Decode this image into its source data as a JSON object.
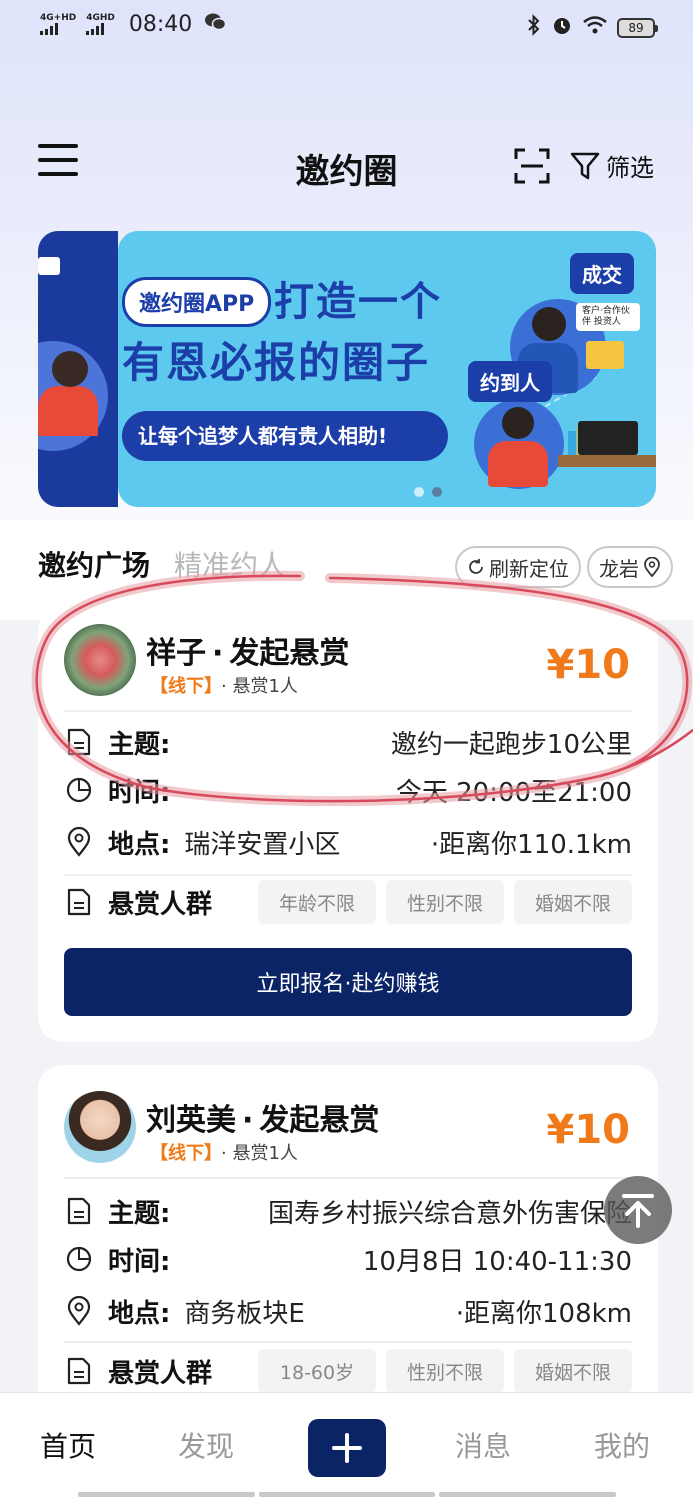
{
  "status_bar": {
    "network_1": "4G+HD",
    "network_2": "4GHD",
    "time": "08:40",
    "battery": "89",
    "icons": [
      "bluetooth-icon",
      "alarm-icon",
      "wifi-icon",
      "wechat-icon"
    ]
  },
  "header": {
    "title": "邀约圈",
    "filter_label": "筛选"
  },
  "banner": {
    "app_pill": "邀约圈APP",
    "headline_1": "打造一个",
    "headline_2": "有恩必报的圈子",
    "subline": "让每个追梦人都有贵人相助!",
    "tag_deal": "成交",
    "tag_meet": "约到人",
    "note": "客户·合作伙伴 投资人",
    "page_count": 2,
    "active_page": 2
  },
  "tabs": {
    "active": "邀约广场",
    "inactive": "精准约人"
  },
  "chips": {
    "refresh": "刷新定位",
    "location": "龙岩"
  },
  "cards": [
    {
      "poster_name": "祥子",
      "action": "发起悬赏",
      "mode": "【线下】",
      "reward_count": "悬赏1人",
      "reward": "¥10",
      "topic_label": "主题:",
      "topic": "邀约一起跑步10公里",
      "time_label": "时间:",
      "time": "今天 20:00至21:00",
      "place_label": "地点:",
      "place": "瑞洋安置小区",
      "distance": "·距离你110.1km",
      "crowd_label": "悬赏人群",
      "crowd_tags": [
        "年龄不限",
        "性别不限",
        "婚姻不限"
      ],
      "join_button": "立即报名·赴约赚钱"
    },
    {
      "poster_name": "刘英美",
      "action": "发起悬赏",
      "mode": "【线下】",
      "reward_count": "悬赏1人",
      "reward": "¥10",
      "topic_label": "主题:",
      "topic": "国寿乡村振兴综合意外伤害保险",
      "time_label": "时间:",
      "time": "10月8日 10:40-11:30",
      "place_label": "地点:",
      "place": "商务板块E",
      "distance": "·距离你108km",
      "crowd_label": "悬赏人群",
      "crowd_tags": [
        "18-60岁",
        "性别不限",
        "婚姻不限"
      ]
    }
  ],
  "bottom_nav": {
    "home": "首页",
    "discover": "发现",
    "messages": "消息",
    "me": "我的"
  },
  "colors": {
    "accent_navy": "#0b2466",
    "reward_orange": "#f07a1a",
    "banner_blue": "#5ec9ee"
  }
}
